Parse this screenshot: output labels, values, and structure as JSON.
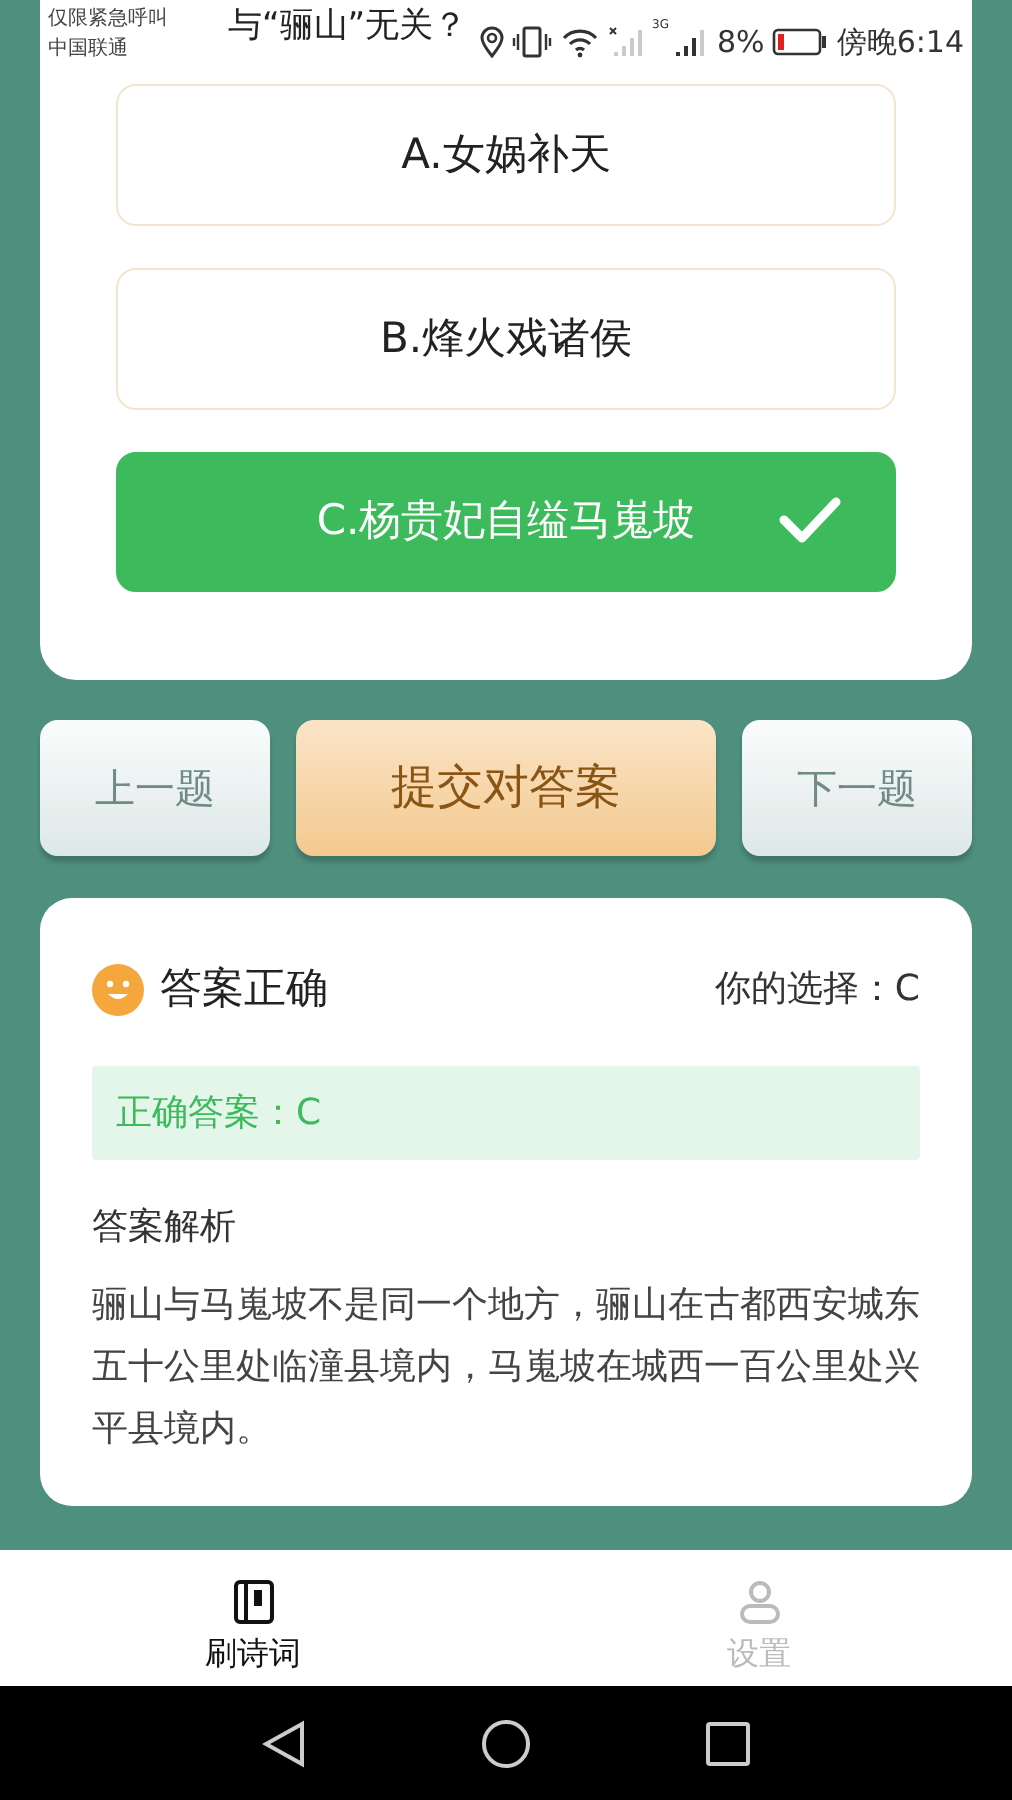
{
  "status_bar": {
    "carrier_note": "仅限紧急呼叫",
    "carrier": "中国联通",
    "network_type": "3G",
    "battery_text": "8%",
    "time": "傍晚6:14"
  },
  "question": {
    "text": "与“骊山”无关？",
    "options": [
      {
        "label": "A.女娲补天",
        "selected": false
      },
      {
        "label": "B.烽火戏诸侯",
        "selected": false
      },
      {
        "label": "C.杨贵妃自缢马嵬坡",
        "selected": true
      }
    ]
  },
  "buttons": {
    "previous": "上一题",
    "submit": "提交对答案",
    "next": "下一题"
  },
  "result": {
    "title": "答案正确",
    "your_choice": "你的选择：C",
    "correct_answer": "正确答案：C",
    "analysis_title": "答案解析",
    "analysis": "骊山与马嵬坡不是同一个地方，骊山在古都西安城东五十公里处临潼县境内，马嵬坡在城西一百公里处兴平县境内。"
  },
  "bottom_nav": [
    {
      "label": "刷诗词",
      "kind": "book",
      "selected": true
    },
    {
      "label": "设置",
      "kind": "person",
      "selected": false
    }
  ]
}
